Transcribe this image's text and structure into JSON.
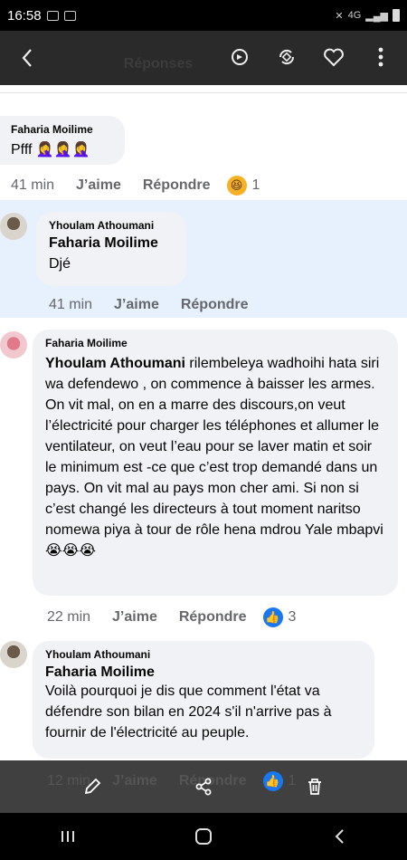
{
  "status": {
    "time": "16:58",
    "network": "4G"
  },
  "header": {
    "title": "Réponses"
  },
  "comments": [
    {
      "author": "Faharia Moilime",
      "text": "Pfff 🤦‍♀️🤦‍♀️🤦‍♀️",
      "time": "41 min",
      "like": "J’aime",
      "reply": "Répondre",
      "reaction": {
        "icon": "haha-emoji",
        "glyph": "😆",
        "count": "1"
      }
    },
    {
      "replying_to": "Yhoulam Athoumani",
      "mention": "Faharia Moilime",
      "text": "Djé",
      "time": "41 min",
      "like": "J’aime",
      "reply": "Répondre"
    },
    {
      "replying_to": "Faharia Moilime",
      "mention": "Yhoulam Athoumani",
      "text_after_mention": "  rilembeleya wadhoihi hata siri wa defendewo , on commence à baisser les armes. On vit mal, on en a marre des discours,on veut l’électricité pour charger les téléphones et allumer le ventilateur, on veut l’eau pour se laver matin et soir le minimum est -ce que c’est trop demandé dans un pays. On vit mal au pays mon cher ami. Si non si c’est changé les directeurs à tout moment naritso nomewa piya à tour de rôle hena mdrou Yale mbapvi 😭😭😭",
      "time": "22 min",
      "like": "J’aime",
      "reply": "Répondre",
      "reaction": {
        "icon": "like-thumb",
        "glyph": "👍",
        "count": "3"
      }
    },
    {
      "replying_to": "Yhoulam Athoumani",
      "mention": "Faharia Moilime",
      "text": "Voilà pourquoi je dis que comment l'état va défendre son bilan en 2024 s'il n'arrive pas à fournir de l'électricité au peuple.",
      "time": "12 min",
      "like": "J’aime",
      "reply": "Répondre",
      "reaction": {
        "icon": "like-thumb",
        "glyph": "👍",
        "count": "1"
      }
    }
  ],
  "colors": {
    "highlight": "#e7f0fd",
    "bubble": "#f0f2f5",
    "meta": "#65676b"
  }
}
